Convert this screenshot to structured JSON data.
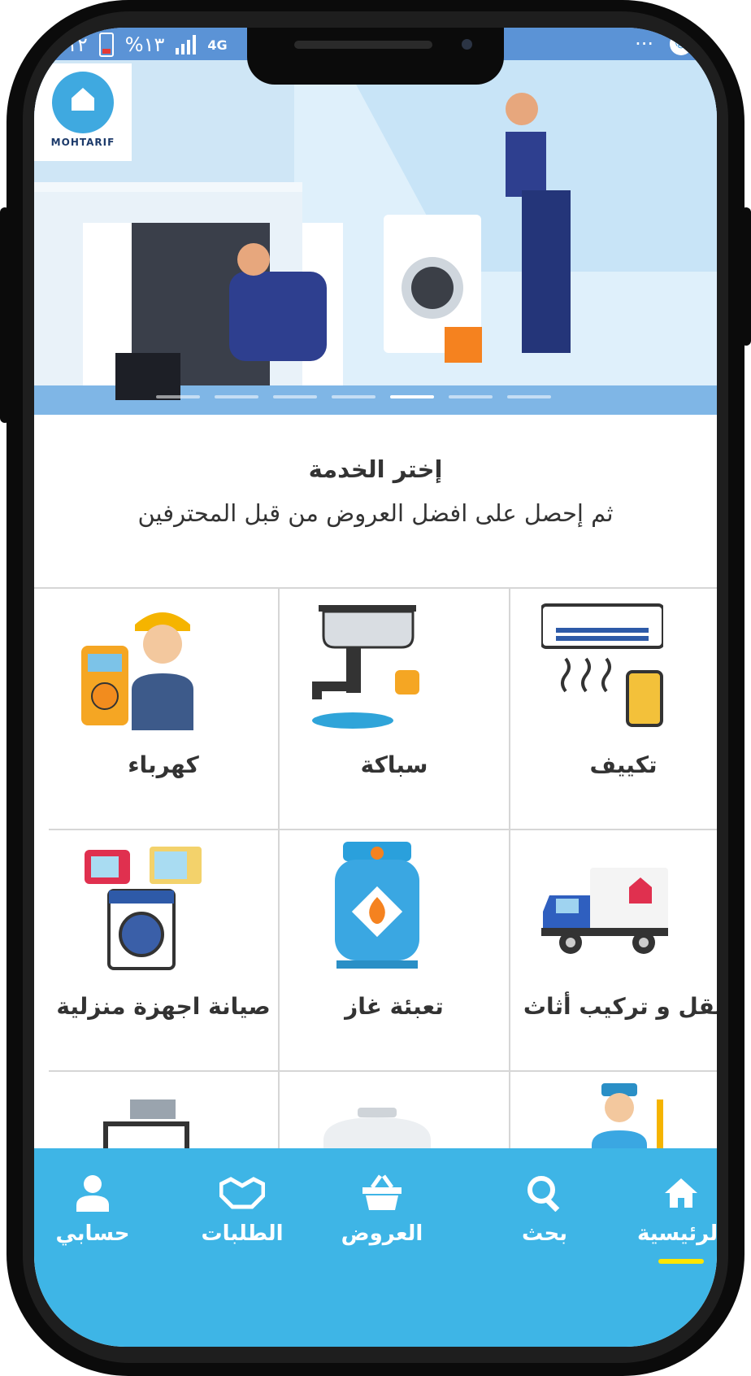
{
  "status_bar": {
    "left_text": "١٢",
    "battery_percent": "%١٣",
    "network": "4G",
    "overflow": "···"
  },
  "banner": {
    "logo_text": "MOHTARIF",
    "slide_count": 7,
    "active_slide": 4
  },
  "header": {
    "title": "إختر الخدمة",
    "subtitle": "ثم إحصل على افضل العروض من قبل المحترفين"
  },
  "services": [
    {
      "label": "تكييف",
      "icon": "air-conditioner-icon"
    },
    {
      "label": "سباكة",
      "icon": "plumbing-sink-icon"
    },
    {
      "label": "كهرباء",
      "icon": "electrician-icon"
    },
    {
      "label": "نقل و تركيب أثاث",
      "icon": "moving-truck-icon"
    },
    {
      "label": "تعبئة غاز",
      "icon": "gas-cylinder-icon"
    },
    {
      "label": "صيانة اجهزة منزلية",
      "icon": "home-appliances-icon"
    }
  ],
  "bottom_nav": {
    "items": [
      {
        "label": "الرئيسية",
        "icon": "home-icon",
        "active": true
      },
      {
        "label": "بحث",
        "icon": "search-icon",
        "active": false
      },
      {
        "label": "العروض",
        "icon": "basket-icon",
        "active": false
      },
      {
        "label": "الطلبات",
        "icon": "handshake-icon",
        "active": false
      },
      {
        "label": "حسابي",
        "icon": "user-icon",
        "active": false
      }
    ]
  },
  "colors": {
    "accent": "#3eb5e6",
    "indicator": "#ffe600",
    "banner": "#4d86cf"
  }
}
